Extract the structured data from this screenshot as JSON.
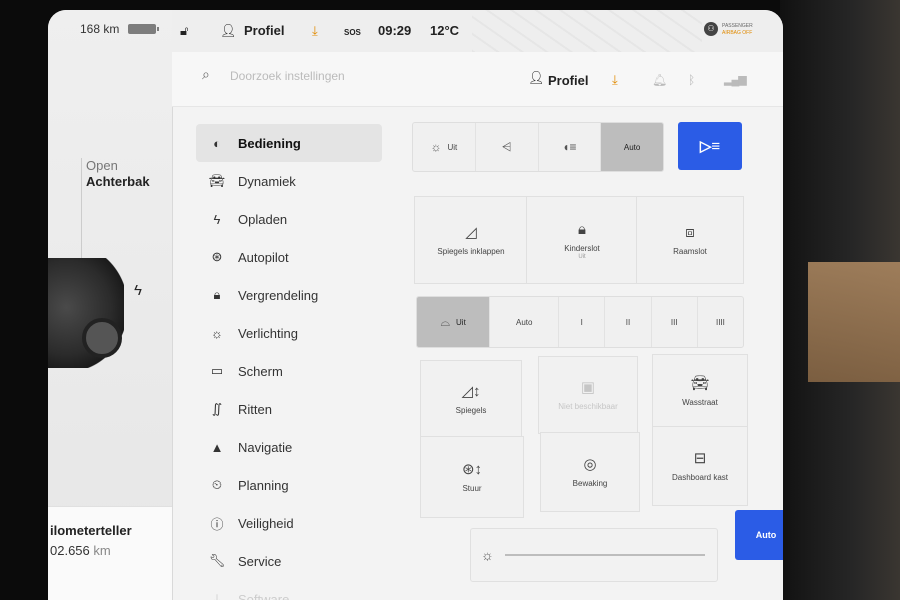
{
  "status": {
    "range": "168 km",
    "profile": "Profiel",
    "sos": "SOS",
    "time": "09:29",
    "temperature": "12°C",
    "airbag_line1": "PASSENGER",
    "airbag_line2": "AIRBAG OFF"
  },
  "car": {
    "trunk_state": "Open",
    "trunk_label": "Achterbak",
    "odometer_label": "ilometerteller",
    "odometer_value": "02.656",
    "odometer_unit": "km"
  },
  "header": {
    "search_placeholder": "Doorzoek instellingen",
    "profile": "Profiel"
  },
  "menu": [
    {
      "label": "Bediening",
      "icon": "toggle-icon"
    },
    {
      "label": "Dynamiek",
      "icon": "car-icon"
    },
    {
      "label": "Opladen",
      "icon": "bolt-icon"
    },
    {
      "label": "Autopilot",
      "icon": "steering-wheel-icon"
    },
    {
      "label": "Vergrendeling",
      "icon": "lock-icon"
    },
    {
      "label": "Verlichting",
      "icon": "sun-icon"
    },
    {
      "label": "Scherm",
      "icon": "display-icon"
    },
    {
      "label": "Ritten",
      "icon": "trips-icon"
    },
    {
      "label": "Navigatie",
      "icon": "navigation-icon"
    },
    {
      "label": "Planning",
      "icon": "clock-icon"
    },
    {
      "label": "Veiligheid",
      "icon": "alert-icon"
    },
    {
      "label": "Service",
      "icon": "wrench-icon"
    },
    {
      "label": "Software",
      "icon": "download-icon"
    }
  ],
  "headlights": {
    "options": [
      "Uit",
      "",
      "",
      "Auto"
    ],
    "selected": "Auto"
  },
  "tiles_row1": [
    {
      "label": "Spiegels inklappen",
      "sub": ""
    },
    {
      "label": "Kinderslot",
      "sub": "Uit"
    },
    {
      "label": "Raamslot",
      "sub": ""
    }
  ],
  "wipers": {
    "options": [
      "Uit",
      "Auto",
      "I",
      "II",
      "III",
      "IIII"
    ],
    "selected": "Uit"
  },
  "tiles_row2": [
    {
      "label": "Spiegels"
    },
    {
      "label": "Niet beschikbaar"
    },
    {
      "label": "Wasstraat"
    },
    {
      "label": "Stuur"
    },
    {
      "label": "Bewaking"
    },
    {
      "label": "Dashboard kast"
    }
  ],
  "brightness": {
    "auto_label": "Auto"
  },
  "colors": {
    "accent_blue": "#2b5ce6",
    "download_orange": "#e08a00"
  }
}
